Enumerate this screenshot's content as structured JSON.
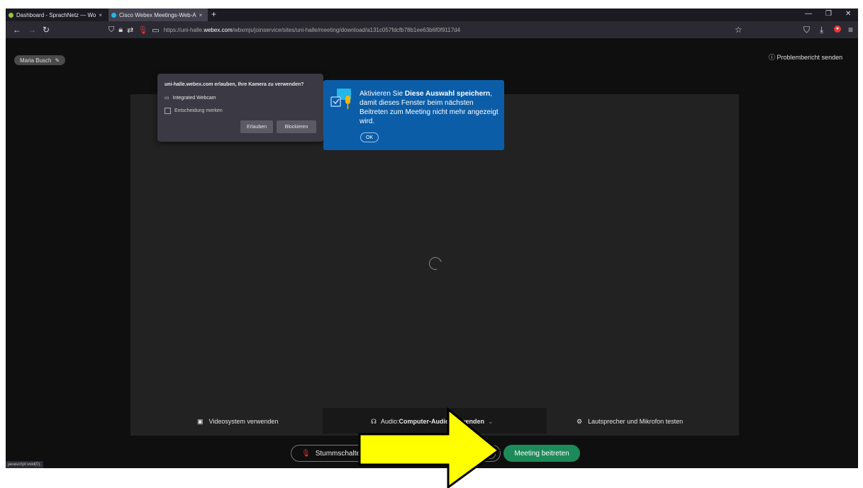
{
  "tabs": [
    {
      "title": "Dashboard - SprachNetz — Wo",
      "close": "×"
    },
    {
      "title": "Cisco Webex Meetings-Web-A",
      "close": "×"
    }
  ],
  "new_tab": "+",
  "window_controls": {
    "minimize": "—",
    "maximize": "❐",
    "close": "✕"
  },
  "nav": {
    "back": "←",
    "forward": "→",
    "reload": "↻"
  },
  "url": {
    "prefix": "https://uni-halle.",
    "domain": "webex.com",
    "path": "/wbxmjs/joinservice/sites/uni-halle/meeting/download/a131c057fdcfb78b1ee63b6f0f9117d4"
  },
  "user_chip": "Maria Busch",
  "problem_report": "Problembericht senden",
  "permission": {
    "question": "uni-halle.webex.com erlauben, Ihre Kamera zu verwenden?",
    "camera": "Integrated Webcam",
    "remember": "Entscheidung merken",
    "allow": "Erlauben",
    "block": "Blockieren"
  },
  "tooltip": {
    "prefix": "Aktivieren Sie ",
    "bold": "Diese Auswahl speichern",
    "suffix": ", damit dieses Fenster beim nächsten Beitreten zum Meeting nicht mehr angezeigt wird.",
    "ok": "OK"
  },
  "options": {
    "video": "Videosystem verwenden",
    "audio_prefix": "Audio: ",
    "audio_value": "Computer-Audio verwenden",
    "speaker": "Lautsprecher und Mikrofon testen"
  },
  "mute_button": "Stummschalten",
  "join_button": "Meeting beitreten",
  "status_text": "javascript:void(0);",
  "colors": {
    "join": "#1d8a59",
    "tooltip": "#0b5da8",
    "arrow": "#ffff00"
  }
}
